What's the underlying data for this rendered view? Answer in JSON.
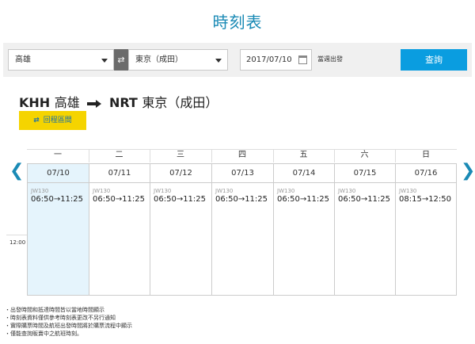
{
  "page": {
    "title": "時刻表"
  },
  "search": {
    "origin": "高雄",
    "destination": "東京（成田）",
    "swap_icon": "⇄",
    "date": "2017/07/10",
    "week_label": "當週出發",
    "query_label": "查詢"
  },
  "route": {
    "origin_code": "KHH",
    "origin_name": "高雄",
    "dest_code": "NRT",
    "dest_name": "東京（成田）",
    "return_icon": "⇄",
    "return_label": "回程區間"
  },
  "nav": {
    "prev": "❮",
    "next": "❯"
  },
  "weekdays": [
    "一",
    "二",
    "三",
    "四",
    "五",
    "六",
    "日"
  ],
  "days": [
    {
      "date": "07/10",
      "flight": "JW130",
      "time": "06:50→11:25",
      "selected": true
    },
    {
      "date": "07/11",
      "flight": "JW130",
      "time": "06:50→11:25",
      "selected": false
    },
    {
      "date": "07/12",
      "flight": "JW130",
      "time": "06:50→11:25",
      "selected": false
    },
    {
      "date": "07/13",
      "flight": "JW130",
      "time": "06:50→11:25",
      "selected": false
    },
    {
      "date": "07/14",
      "flight": "JW130",
      "time": "06:50→11:25",
      "selected": false
    },
    {
      "date": "07/15",
      "flight": "JW130",
      "time": "06:50→11:25",
      "selected": false
    },
    {
      "date": "07/16",
      "flight": "JW130",
      "time": "08:15→12:50",
      "selected": false
    }
  ],
  "time_axis": {
    "noon": "12:00"
  },
  "notes": [
    "・出發時間和抵達時間皆以當地時間顯示",
    "・時刻表資料僅供參考時刻表更改不另行通知",
    "・實際購票時間及航班出發時間將於購票流程中顯示",
    "・僅能查詢販賣中之航班時刻。"
  ],
  "colors": {
    "accent": "#1a8ab5",
    "query_button": "#0a9de0",
    "return_button": "#f5d400",
    "today_column": "#e5f4fc"
  }
}
